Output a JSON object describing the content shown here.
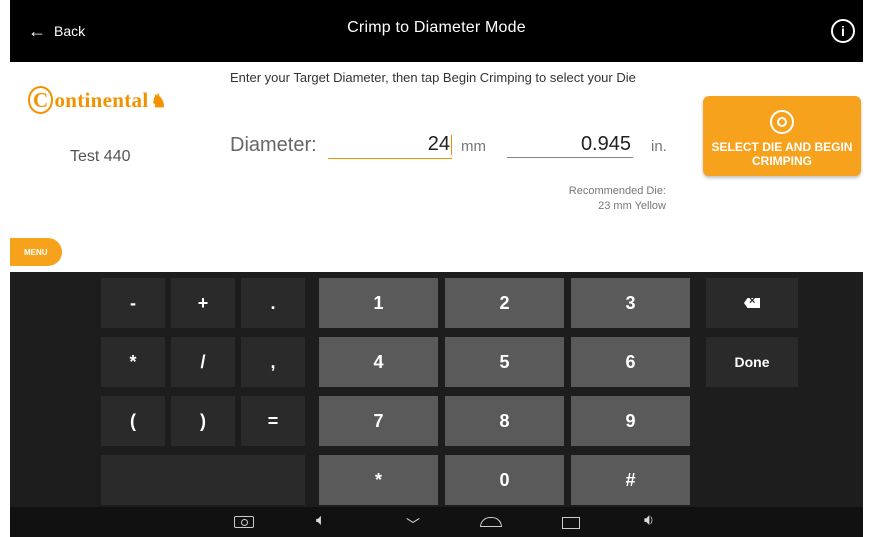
{
  "topbar": {
    "back_label": "Back",
    "title": "Crimp to Diameter Mode"
  },
  "brand": {
    "logo_text": "Ontinental",
    "logo_prefix": "C"
  },
  "device_name": "Test 440",
  "instruction": "Enter your Target Diameter, then tap Begin Crimping to select your Die",
  "diameter": {
    "label": "Diameter:",
    "mm_value": "24",
    "mm_unit": "mm",
    "in_value": "0.945",
    "in_unit": "in."
  },
  "recommended": {
    "line1": "Recommended Die:",
    "line2": "23 mm Yellow"
  },
  "cta": {
    "label": "SELECT DIE AND BEGIN CRIMPING"
  },
  "menu_label": "MENU",
  "keyboard": {
    "row1": [
      "-",
      "+",
      ".",
      "1",
      "2",
      "3"
    ],
    "row2": [
      "*",
      "/",
      ",",
      "4",
      "5",
      "6"
    ],
    "row3": [
      "(",
      ")",
      "=",
      "7",
      "8",
      "9"
    ],
    "row4": [
      "*",
      "0",
      "#"
    ],
    "done_label": "Done"
  },
  "colors": {
    "accent": "#f6a21d",
    "topbar": "#000000",
    "keyboard_bg": "#1d1d1d"
  }
}
